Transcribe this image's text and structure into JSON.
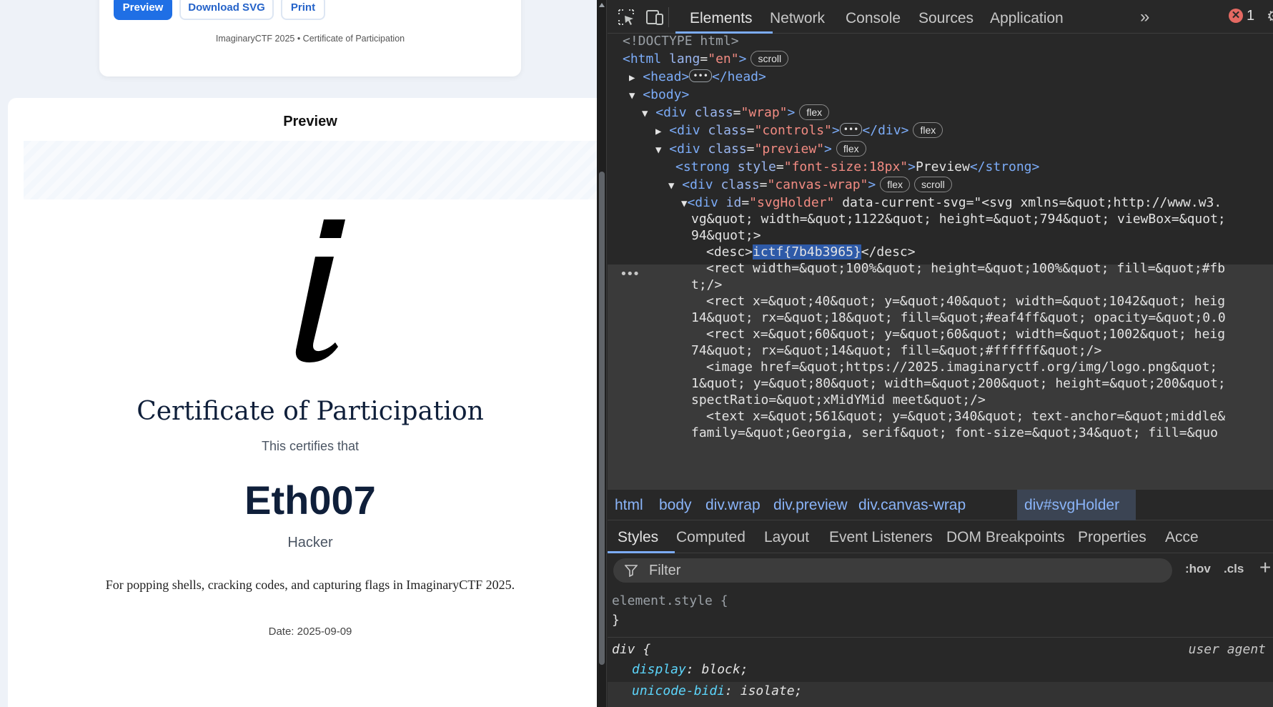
{
  "page": {
    "controls": {
      "preview_label": "Preview",
      "download_label": "Download SVG",
      "print_label": "Print",
      "footer": "ImaginaryCTF 2025 • Certificate of Participation"
    },
    "preview": {
      "heading": "Preview",
      "certificate": {
        "title": "Certificate of Participation",
        "certifies": "This certifies that",
        "name": "Eth007",
        "role": "Hacker",
        "reason": "For popping shells, cracking codes, and capturing flags in ImaginaryCTF 2025.",
        "date": "Date: 2025-09-09"
      }
    }
  },
  "devtools": {
    "tabs": [
      "Elements",
      "Network",
      "Console",
      "Sources",
      "Application"
    ],
    "more_tabs": "»",
    "error_count": "1",
    "dom": {
      "doctype": "<!DOCTYPE html>",
      "html_open": "<html ",
      "lang_attr": "lang",
      "lang_val": "\"en\"",
      "badge_scroll": "scroll",
      "badge_flex": "flex",
      "head": "<head>",
      "head_close": "</head>",
      "body": "<body>",
      "div_open": "<div ",
      "div_close": "</div>",
      "class_attr": "class",
      "wrap_val": "\"wrap\"",
      "controls_val": "\"controls\"",
      "preview_val": "\"preview\"",
      "strong_open": "<strong ",
      "style_attr": "style",
      "strong_style_val": "\"font-size:18px\"",
      "strong_text": "Preview",
      "strong_close": "</strong>",
      "canvas_wrap_val": "\"canvas-wrap\"",
      "svgholder_id_attr": "id",
      "svgholder_id_val": "\"svgHolder\"",
      "svg_attr_line1": "data-current-svg=\"<svg xmlns=&quot;http://www.w3.",
      "svg_attr_line2": "vg&quot; width=&quot;1122&quot; height=&quot;794&quot; viewBox=&quot;",
      "svg_attr_line3": "94&quot;>",
      "desc_open": "<desc>",
      "desc_value": "ictf{7b4b3965}",
      "desc_close": "</desc>",
      "rect1_line1": "<rect width=&quot;100%&quot; height=&quot;100%&quot; fill=&quot;#fb",
      "rect1_line2": "t;/>",
      "rect2_line1": "<rect x=&quot;40&quot; y=&quot;40&quot; width=&quot;1042&quot; heig",
      "rect2_line2": "14&quot; rx=&quot;18&quot; fill=&quot;#eaf4ff&quot; opacity=&quot;0.0",
      "rect3_line1": "<rect x=&quot;60&quot; y=&quot;60&quot; width=&quot;1002&quot; heig",
      "rect3_line2": "74&quot; rx=&quot;14&quot; fill=&quot;#ffffff&quot;/>",
      "image_line1": "<image href=&quot;https://2025.imaginaryctf.org/img/logo.png&quot;",
      "image_line2": "1&quot; y=&quot;80&quot; width=&quot;200&quot; height=&quot;200&quot;",
      "image_line3": "spectRatio=&quot;xMidYMid meet&quot;/>",
      "text_line1": "<text x=&quot;561&quot; y=&quot;340&quot; text-anchor=&quot;middle&",
      "text_line2": "family=&quot;Georgia, serif&quot; font-size=&quot;34&quot; fill=&quo"
    },
    "breadcrumbs": [
      "html",
      "body",
      "div.wrap",
      "div.preview",
      "div.canvas-wrap",
      "div#svgHolder"
    ],
    "styles_tabs": [
      "Styles",
      "Computed",
      "Layout",
      "Event Listeners",
      "DOM Breakpoints",
      "Properties",
      "Acce"
    ],
    "filter_placeholder": "Filter",
    "hov": ":hov",
    "cls": ".cls",
    "plus": "+",
    "styles": {
      "element_style_sel": "element.style {",
      "close_brace": "}",
      "div_sel": "div {",
      "user_agent": "user agent",
      "p1_name": "display",
      "p1_val": "block;",
      "p2_name": "unicode-bidi",
      "p2_val": "isolate;"
    }
  }
}
